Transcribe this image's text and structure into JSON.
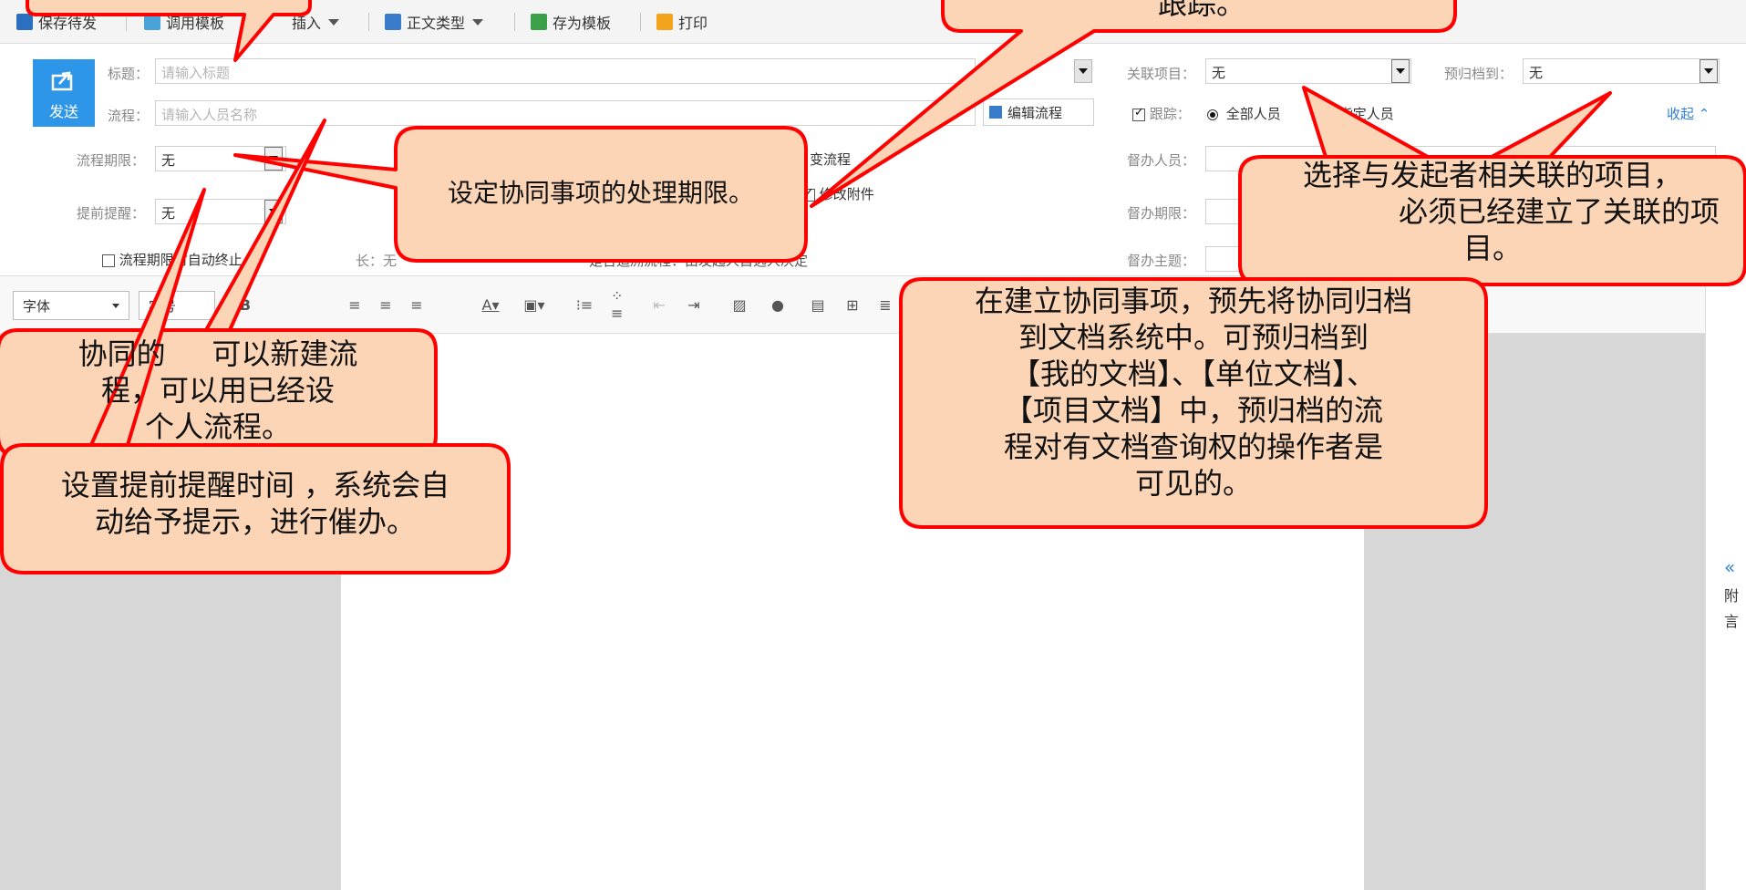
{
  "toolbar": {
    "save_draft": "保存待发",
    "use_template": "调用模板",
    "insert": "插入",
    "body_type": "正文类型",
    "save_template": "存为模板",
    "print": "打印"
  },
  "form": {
    "send_label": "发送",
    "title_label": "标题：",
    "title_placeholder": "请输入标题",
    "flow_label": "流程：",
    "flow_placeholder": "请输入人员名称",
    "edit_flow": "编辑流程",
    "deadline_label": "流程期限：",
    "deadline_value": "无",
    "reminder_label": "提前提醒：",
    "reminder_value": "无",
    "change_flow": "变流程",
    "modify_attachment": "修改附件",
    "auto_terminate": "流程期限时自动终止",
    "extend_label": "长：无",
    "track_note": "是否追溯流程：由发起人自选人决定",
    "related_project_label": "关联项目：",
    "related_project_value": "无",
    "pre_archive_label": "预归档到：",
    "pre_archive_value": "无",
    "track_label": "跟踪：",
    "track_all": "全部人员",
    "track_specific": "指定人员",
    "collapse": "收起",
    "supervisor_label": "督办人员：",
    "supervise_deadline_label": "督办期限：",
    "supervise_subject_label": "督办主题："
  },
  "editor": {
    "font_label": "字体",
    "size_label": "字号"
  },
  "right_strip": {
    "arrow": "«",
    "line1": "附",
    "line2": "言"
  },
  "callouts": {
    "tracking": "跟踪。",
    "deadline": "设定协同事项的处理期限。",
    "project": [
      "选择与发起者相关联的项目，",
      "必须已经建立了关联的项",
      "目。"
    ],
    "archive": [
      "在建立协同事项，预先将协同归档",
      "到文档系统中。可预归档到",
      "【我的文档】、【单位文档】、",
      "【项目文档】中，预归档的流",
      "程对有文档查询权的操作者是",
      "可见的。"
    ],
    "flow": [
      "协同的     可以新建流",
      "程，可以用已经设",
      "个人流程。"
    ],
    "reminder": [
      "设置提前提醒时间 ，系统会自",
      "动给予提示，进行催办。"
    ]
  },
  "colors": {
    "callout_fill": "#fbd5b6",
    "callout_stroke": "#ff0000",
    "send_button": "#2e96e8",
    "link": "#2e7fd8"
  }
}
